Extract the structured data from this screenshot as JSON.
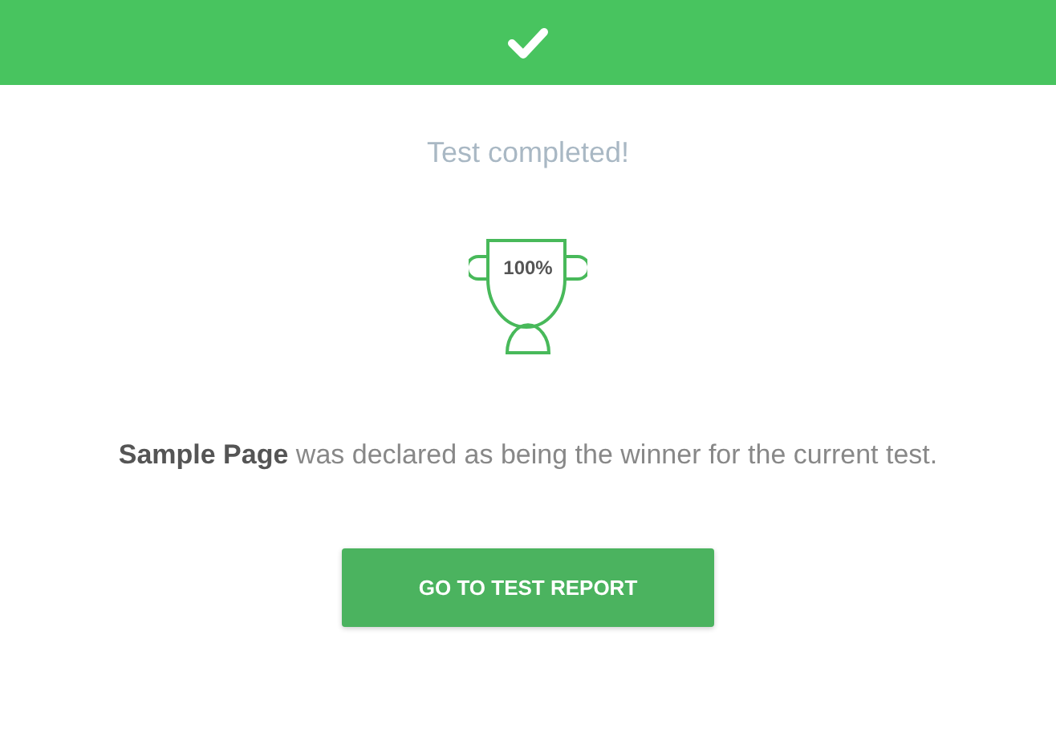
{
  "status": "Test completed!",
  "trophy": {
    "percent": "100%"
  },
  "message": "**Sample Page** was declared as being the winner for the current test.",
  "button": "GO TO TEST REPORT"
}
